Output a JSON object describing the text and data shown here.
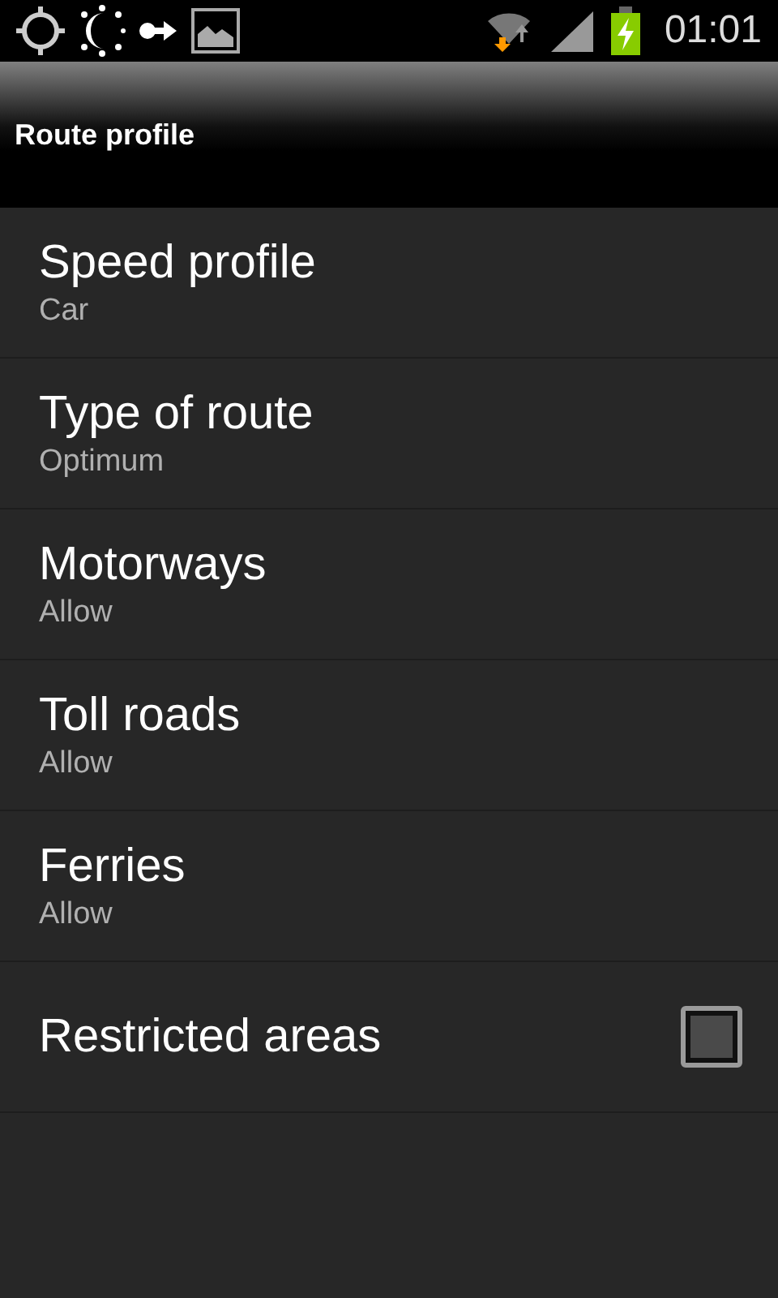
{
  "status_bar": {
    "time": "01:01"
  },
  "title_bar": {
    "title": "Route profile"
  },
  "settings": [
    {
      "kind": "summary",
      "title": "Speed profile",
      "summary": "Car"
    },
    {
      "kind": "summary",
      "title": "Type of route",
      "summary": "Optimum"
    },
    {
      "kind": "summary",
      "title": "Motorways",
      "summary": "Allow"
    },
    {
      "kind": "summary",
      "title": "Toll roads",
      "summary": "Allow"
    },
    {
      "kind": "summary",
      "title": "Ferries",
      "summary": "Allow"
    },
    {
      "kind": "checkbox",
      "title": "Restricted areas",
      "checked": false
    }
  ]
}
